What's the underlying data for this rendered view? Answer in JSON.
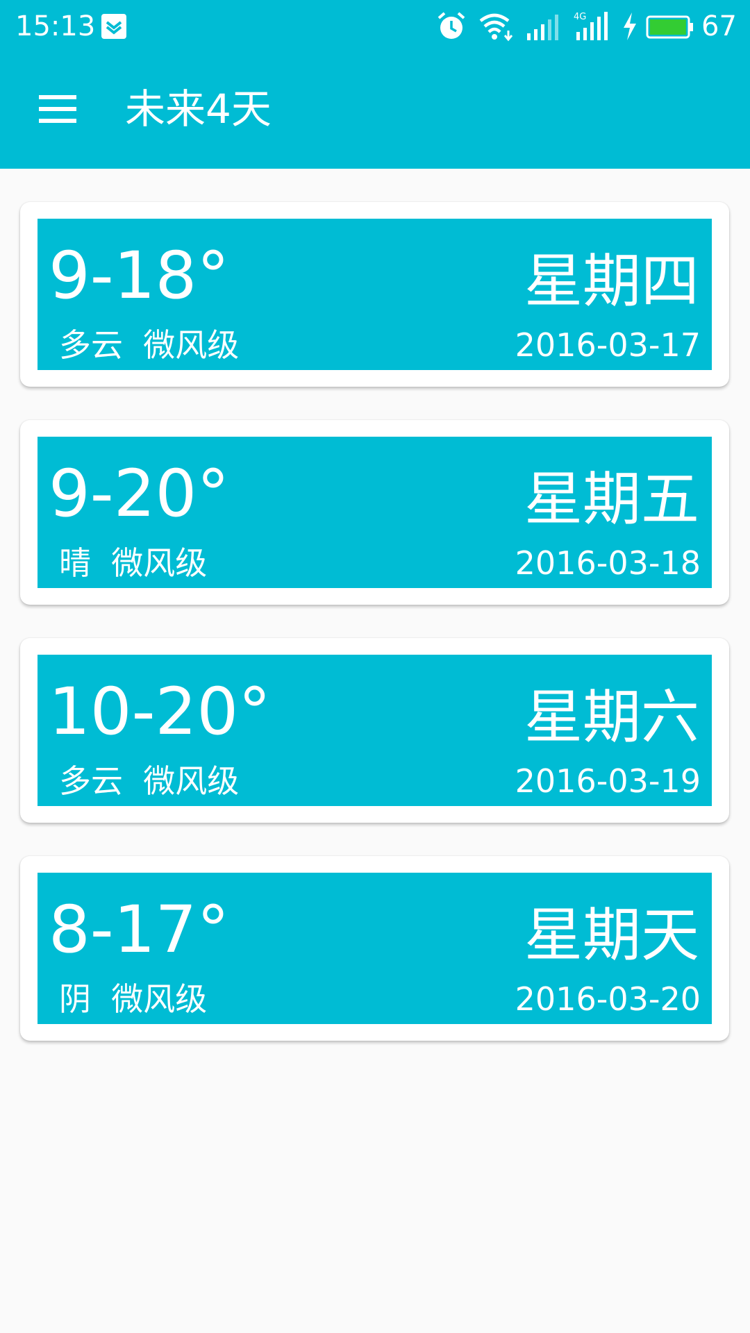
{
  "status_bar": {
    "time": "15:13",
    "battery_percent": "67",
    "icons": [
      "notification-icon",
      "alarm-icon",
      "wifi-icon",
      "signal-icon",
      "signal-4g-icon",
      "charging-icon",
      "battery-icon"
    ]
  },
  "toolbar": {
    "menu_icon": "hamburger-menu-icon",
    "title": "未来4天"
  },
  "colors": {
    "primary": "#00bcd4",
    "background": "#fafafa",
    "card": "#ffffff",
    "battery_fill": "#33cc33"
  },
  "forecast": [
    {
      "temp": "9-18°",
      "condition": "多云",
      "wind": "微风级",
      "weekday": "星期四",
      "date": "2016-03-17"
    },
    {
      "temp": "9-20°",
      "condition": "晴",
      "wind": "微风级",
      "weekday": "星期五",
      "date": "2016-03-18"
    },
    {
      "temp": "10-20°",
      "condition": "多云",
      "wind": "微风级",
      "weekday": "星期六",
      "date": "2016-03-19"
    },
    {
      "temp": "8-17°",
      "condition": "阴",
      "wind": "微风级",
      "weekday": "星期天",
      "date": "2016-03-20"
    }
  ]
}
